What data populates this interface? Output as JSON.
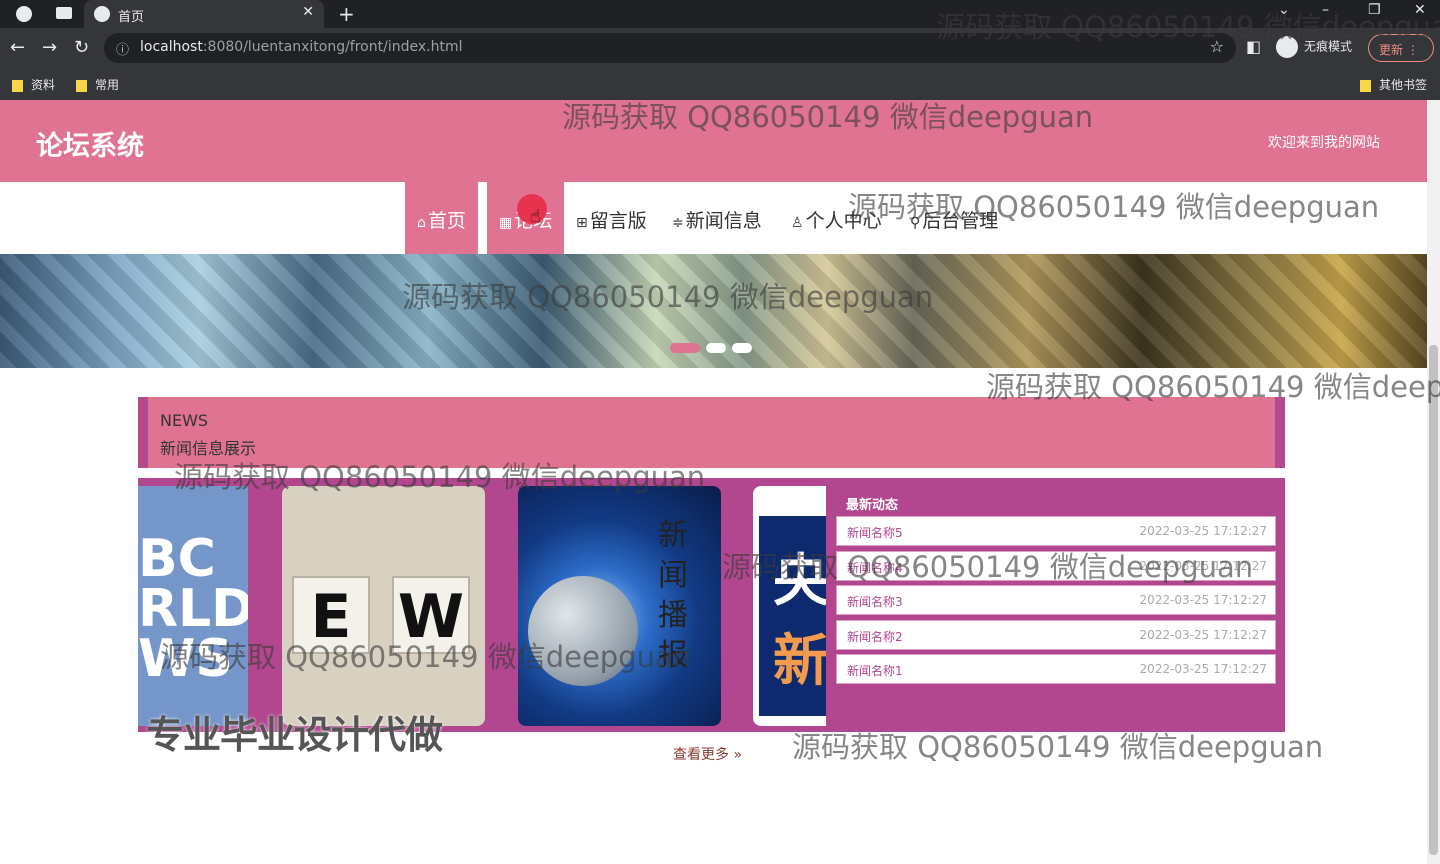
{
  "browser": {
    "tab_title": "首页",
    "url_host": "localhost",
    "url_rest": ":8080/luentanxitong/front/index.html",
    "incognito_label": "无痕模式",
    "update_label": "更新",
    "bookmarks": [
      "资料",
      "常用"
    ],
    "other_bookmarks": "其他书签"
  },
  "header": {
    "logo": "论坛系统",
    "welcome": "欢迎来到我的网站"
  },
  "menu": {
    "home": "首页",
    "forum": "论坛",
    "messages": "留言版",
    "news": "新闻信息",
    "profile": "个人中心",
    "admin": "后台管理"
  },
  "news_section": {
    "title_en": "NEWS",
    "title_cn": "新闻信息展示",
    "latest_heading": "最新动态",
    "items": [
      {
        "name": "新闻名称5",
        "date": "2022-03-25 17:12:27"
      },
      {
        "name": "新闻名称4",
        "date": "2022-03-25 17:12:27"
      },
      {
        "name": "新闻名称3",
        "date": "2022-03-25 17:12:27"
      },
      {
        "name": "新闻名称2",
        "date": "2022-03-25 17:12:27"
      },
      {
        "name": "新闻名称1",
        "date": "2022-03-25 17:12:27"
      }
    ],
    "more_label": "查看更多 »",
    "image_texts": {
      "pic1": "BC\nRLD\nWS",
      "pic3": "新闻播报",
      "pic4_a": "央",
      "pic4_b": "新"
    }
  },
  "overlay_text": "专业毕业设计代做",
  "watermark": "源码获取 QQ86050149 微信deepguan"
}
